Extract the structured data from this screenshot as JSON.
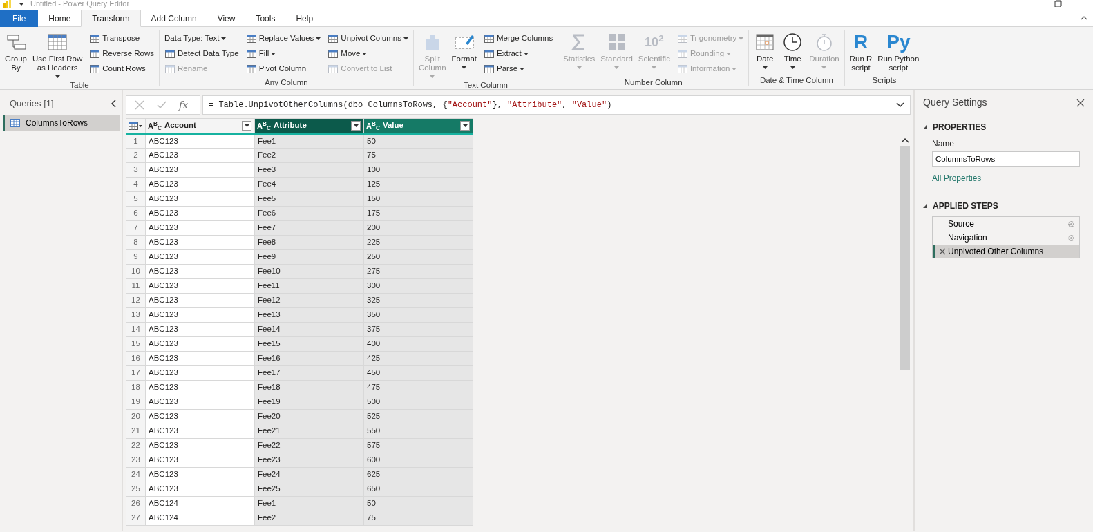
{
  "window": {
    "title": "Untitled - Power Query Editor"
  },
  "tabs": [
    {
      "label": "File",
      "kind": "file",
      "selected": false
    },
    {
      "label": "Home",
      "kind": "tab",
      "selected": false
    },
    {
      "label": "Transform",
      "kind": "tab",
      "selected": true
    },
    {
      "label": "Add Column",
      "kind": "tab",
      "selected": false
    },
    {
      "label": "View",
      "kind": "tab",
      "selected": false
    },
    {
      "label": "Tools",
      "kind": "tab",
      "selected": false
    },
    {
      "label": "Help",
      "kind": "tab",
      "selected": false
    }
  ],
  "ribbon": {
    "groups": [
      {
        "label": "Table",
        "columns": [
          {
            "kind": "large",
            "items": [
              {
                "label": "Group\nBy",
                "disabled": false,
                "dropdown": false
              },
              {
                "label": "Use First Row\nas Headers",
                "disabled": false,
                "dropdown": true
              }
            ]
          },
          {
            "kind": "small",
            "items": [
              {
                "label": "Transpose",
                "disabled": false,
                "dropdown": false
              },
              {
                "label": "Reverse Rows",
                "disabled": false,
                "dropdown": false
              },
              {
                "label": "Count Rows",
                "disabled": false,
                "dropdown": false
              }
            ]
          }
        ]
      },
      {
        "label": "Any Column",
        "columns": [
          {
            "kind": "small",
            "items": [
              {
                "label": "Data Type: Text",
                "disabled": false,
                "dropdown": true,
                "noicon": true
              },
              {
                "label": "Detect Data Type",
                "disabled": false,
                "dropdown": false
              },
              {
                "label": "Rename",
                "disabled": true,
                "dropdown": false
              }
            ]
          },
          {
            "kind": "small",
            "items": [
              {
                "label": "Replace Values",
                "disabled": false,
                "dropdown": true
              },
              {
                "label": "Fill",
                "disabled": false,
                "dropdown": true
              },
              {
                "label": "Pivot Column",
                "disabled": false,
                "dropdown": false
              }
            ]
          },
          {
            "kind": "small",
            "items": [
              {
                "label": "Unpivot Columns",
                "disabled": false,
                "dropdown": true
              },
              {
                "label": "Move",
                "disabled": false,
                "dropdown": true
              },
              {
                "label": "Convert to List",
                "disabled": true,
                "dropdown": false
              }
            ]
          }
        ]
      },
      {
        "label": "Text Column",
        "columns": [
          {
            "kind": "large",
            "items": [
              {
                "label": "Split\nColumn",
                "disabled": true,
                "dropdown": true
              },
              {
                "label": "Format",
                "disabled": false,
                "dropdown": true
              }
            ]
          },
          {
            "kind": "small",
            "items": [
              {
                "label": "Merge Columns",
                "disabled": false,
                "dropdown": false
              },
              {
                "label": "Extract",
                "disabled": false,
                "dropdown": true
              },
              {
                "label": "Parse",
                "disabled": false,
                "dropdown": true
              }
            ]
          }
        ]
      },
      {
        "label": "Number Column",
        "columns": [
          {
            "kind": "large",
            "items": [
              {
                "label": "Statistics",
                "disabled": true,
                "dropdown": true
              },
              {
                "label": "Standard",
                "disabled": true,
                "dropdown": true
              },
              {
                "label": "Scientific",
                "disabled": true,
                "dropdown": true,
                "glyph": "10$^{2}$"
              }
            ]
          },
          {
            "kind": "small",
            "items": [
              {
                "label": "Trigonometry",
                "disabled": true,
                "dropdown": true
              },
              {
                "label": "Rounding",
                "disabled": true,
                "dropdown": true
              },
              {
                "label": "Information",
                "disabled": true,
                "dropdown": true
              }
            ]
          }
        ]
      },
      {
        "label": "Date & Time Column",
        "columns": [
          {
            "kind": "large",
            "items": [
              {
                "label": "Date",
                "disabled": false,
                "dropdown": true
              },
              {
                "label": "Time",
                "disabled": false,
                "dropdown": true
              },
              {
                "label": "Duration",
                "disabled": true,
                "dropdown": true
              }
            ]
          }
        ]
      },
      {
        "label": "Scripts",
        "columns": [
          {
            "kind": "large",
            "items": [
              {
                "label": "Run R\nscript",
                "disabled": false,
                "dropdown": false,
                "glyph": "R"
              },
              {
                "label": "Run Python\nscript",
                "disabled": false,
                "dropdown": false,
                "glyph": "Py"
              }
            ]
          }
        ]
      }
    ]
  },
  "queries": {
    "title": "Queries [1]",
    "items": [
      {
        "label": "ColumnsToRows",
        "selected": true
      }
    ]
  },
  "formula_bar": {
    "fx": "fx",
    "parts": [
      {
        "text": "= Table.UnpivotOtherColumns(dbo_ColumnsToRows, {",
        "kind": "code"
      },
      {
        "text": "\"Account\"",
        "kind": "string"
      },
      {
        "text": "}, ",
        "kind": "code"
      },
      {
        "text": "\"Attribute\"",
        "kind": "string"
      },
      {
        "text": ", ",
        "kind": "code"
      },
      {
        "text": "\"Value\"",
        "kind": "string"
      },
      {
        "text": ")",
        "kind": "code"
      }
    ]
  },
  "table": {
    "columns": [
      {
        "label": "Account",
        "type_label": "A$^{B}$$_{C}$",
        "selected": false,
        "focused": false
      },
      {
        "label": "Attribute",
        "type_label": "A$^{B}$$_{C}$",
        "selected": true,
        "focused": true
      },
      {
        "label": "Value",
        "type_label": "A$^{B}$$_{C}$",
        "selected": true,
        "focused": false
      }
    ],
    "rows": [
      {
        "n": "1",
        "cells": [
          "ABC123",
          "Fee1",
          "50"
        ]
      },
      {
        "n": "2",
        "cells": [
          "ABC123",
          "Fee2",
          "75"
        ]
      },
      {
        "n": "3",
        "cells": [
          "ABC123",
          "Fee3",
          "100"
        ]
      },
      {
        "n": "4",
        "cells": [
          "ABC123",
          "Fee4",
          "125"
        ]
      },
      {
        "n": "5",
        "cells": [
          "ABC123",
          "Fee5",
          "150"
        ]
      },
      {
        "n": "6",
        "cells": [
          "ABC123",
          "Fee6",
          "175"
        ]
      },
      {
        "n": "7",
        "cells": [
          "ABC123",
          "Fee7",
          "200"
        ]
      },
      {
        "n": "8",
        "cells": [
          "ABC123",
          "Fee8",
          "225"
        ]
      },
      {
        "n": "9",
        "cells": [
          "ABC123",
          "Fee9",
          "250"
        ]
      },
      {
        "n": "10",
        "cells": [
          "ABC123",
          "Fee10",
          "275"
        ]
      },
      {
        "n": "11",
        "cells": [
          "ABC123",
          "Fee11",
          "300"
        ]
      },
      {
        "n": "12",
        "cells": [
          "ABC123",
          "Fee12",
          "325"
        ]
      },
      {
        "n": "13",
        "cells": [
          "ABC123",
          "Fee13",
          "350"
        ]
      },
      {
        "n": "14",
        "cells": [
          "ABC123",
          "Fee14",
          "375"
        ]
      },
      {
        "n": "15",
        "cells": [
          "ABC123",
          "Fee15",
          "400"
        ]
      },
      {
        "n": "16",
        "cells": [
          "ABC123",
          "Fee16",
          "425"
        ]
      },
      {
        "n": "17",
        "cells": [
          "ABC123",
          "Fee17",
          "450"
        ]
      },
      {
        "n": "18",
        "cells": [
          "ABC123",
          "Fee18",
          "475"
        ]
      },
      {
        "n": "19",
        "cells": [
          "ABC123",
          "Fee19",
          "500"
        ]
      },
      {
        "n": "20",
        "cells": [
          "ABC123",
          "Fee20",
          "525"
        ]
      },
      {
        "n": "21",
        "cells": [
          "ABC123",
          "Fee21",
          "550"
        ]
      },
      {
        "n": "22",
        "cells": [
          "ABC123",
          "Fee22",
          "575"
        ]
      },
      {
        "n": "23",
        "cells": [
          "ABC123",
          "Fee23",
          "600"
        ]
      },
      {
        "n": "24",
        "cells": [
          "ABC123",
          "Fee24",
          "625"
        ]
      },
      {
        "n": "25",
        "cells": [
          "ABC123",
          "Fee25",
          "650"
        ]
      },
      {
        "n": "26",
        "cells": [
          "ABC124",
          "Fee1",
          "50"
        ]
      },
      {
        "n": "27",
        "cells": [
          "ABC124",
          "Fee2",
          "75"
        ]
      }
    ]
  },
  "query_settings": {
    "title": "Query Settings",
    "properties_heading": "PROPERTIES",
    "name_label": "Name",
    "name_value": "ColumnsToRows",
    "all_properties": "All Properties",
    "steps_heading": "APPLIED STEPS",
    "steps": [
      {
        "label": "Source",
        "selected": false,
        "settings": true
      },
      {
        "label": "Navigation",
        "selected": false,
        "settings": true
      },
      {
        "label": "Unpivoted Other Columns",
        "selected": true,
        "settings": false
      }
    ]
  }
}
